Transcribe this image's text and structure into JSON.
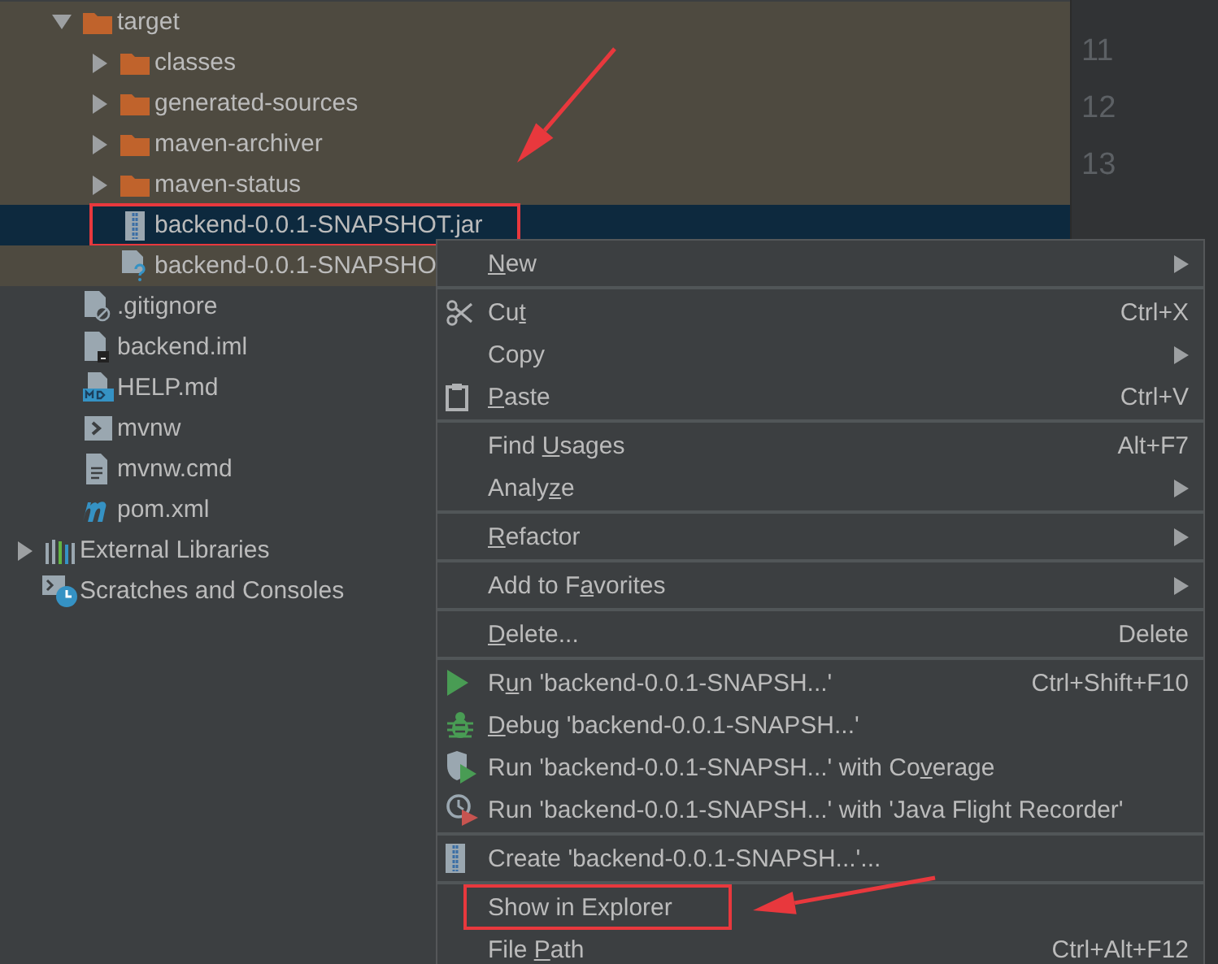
{
  "tree": [
    {
      "kind": "group",
      "children": [
        {
          "kind": "folder",
          "label": "target",
          "expanded": true,
          "selected": false,
          "excluded": true,
          "framed": false,
          "children": [
            {
              "kind": "folder",
              "label": "classes",
              "expanded": false,
              "selected": false,
              "framed": false
            },
            {
              "kind": "folder",
              "label": "generated-sources",
              "expanded": false,
              "selected": false,
              "framed": false
            },
            {
              "kind": "folder",
              "label": "maven-archiver",
              "expanded": false,
              "selected": false,
              "framed": false
            },
            {
              "kind": "folder",
              "label": "maven-status",
              "expanded": false,
              "selected": false,
              "framed": false
            },
            {
              "kind": "jar",
              "label": "backend-0.0.1-SNAPSHOT.jar",
              "selected": true,
              "framed": true
            },
            {
              "kind": "unknown",
              "label": "backend-0.0.1-SNAPSHO",
              "selected": false,
              "framed": false
            }
          ]
        },
        {
          "kind": "gitignore",
          "label": ".gitignore",
          "selected": false,
          "excluded": false,
          "framed": false
        },
        {
          "kind": "iml",
          "label": "backend.iml",
          "selected": false,
          "excluded": false,
          "framed": false
        },
        {
          "kind": "markdown",
          "label": "HELP.md",
          "selected": false,
          "excluded": false,
          "framed": false
        },
        {
          "kind": "shell",
          "label": "mvnw",
          "selected": false,
          "excluded": false,
          "framed": false
        },
        {
          "kind": "text",
          "label": "mvnw.cmd",
          "selected": false,
          "excluded": false,
          "framed": false
        },
        {
          "kind": "maven",
          "label": "pom.xml",
          "selected": false,
          "excluded": false,
          "framed": false
        }
      ]
    },
    {
      "kind": "libraries",
      "label": "External Libraries",
      "expanded": false,
      "selected": false,
      "framed": false
    },
    {
      "kind": "scratches",
      "label": "Scratches and Consoles",
      "selected": false,
      "framed": false
    }
  ],
  "gutter": {
    "line_numbers": [
      "11",
      "12",
      "13"
    ]
  },
  "context_menu": {
    "groups": [
      [
        {
          "kind": "plain",
          "label": [
            {
              "text": "N",
              "underlined": true
            },
            {
              "text": "ew",
              "underlined": false
            }
          ],
          "submenu": true
        }
      ],
      [
        {
          "kind": "cut",
          "label": [
            {
              "text": "Cu",
              "underlined": false
            },
            {
              "text": "t",
              "underlined": true
            }
          ],
          "shortcut": "Ctrl+X"
        },
        {
          "kind": "plain",
          "label": [
            {
              "text": "Copy",
              "underlined": false
            }
          ],
          "submenu": true
        },
        {
          "kind": "paste",
          "label": [
            {
              "text": "P",
              "underlined": true
            },
            {
              "text": "aste",
              "underlined": false
            }
          ],
          "shortcut": "Ctrl+V"
        }
      ],
      [
        {
          "kind": "plain",
          "label": [
            {
              "text": "Find ",
              "underlined": false
            },
            {
              "text": "U",
              "underlined": true
            },
            {
              "text": "sages",
              "underlined": false
            }
          ],
          "shortcut": "Alt+F7"
        },
        {
          "kind": "plain",
          "label": [
            {
              "text": "Analy",
              "underlined": false
            },
            {
              "text": "z",
              "underlined": true
            },
            {
              "text": "e",
              "underlined": false
            }
          ],
          "submenu": true
        }
      ],
      [
        {
          "kind": "plain",
          "label": [
            {
              "text": "R",
              "underlined": true
            },
            {
              "text": "efactor",
              "underlined": false
            }
          ],
          "submenu": true
        }
      ],
      [
        {
          "kind": "plain",
          "label": [
            {
              "text": "Add to F",
              "underlined": false
            },
            {
              "text": "a",
              "underlined": true
            },
            {
              "text": "vorites",
              "underlined": false
            }
          ],
          "submenu": true
        }
      ],
      [
        {
          "kind": "plain",
          "label": [
            {
              "text": "D",
              "underlined": true
            },
            {
              "text": "elete...",
              "underlined": false
            }
          ],
          "shortcut": "Delete"
        }
      ],
      [
        {
          "kind": "run",
          "label": [
            {
              "text": "R",
              "underlined": false
            },
            {
              "text": "u",
              "underlined": true
            },
            {
              "text": "n 'backend-0.0.1-SNAPSH...'",
              "underlined": false
            }
          ],
          "shortcut": "Ctrl+Shift+F10"
        },
        {
          "kind": "debug",
          "label": [
            {
              "text": "D",
              "underlined": true
            },
            {
              "text": "ebug 'backend-0.0.1-SNAPSH...'",
              "underlined": false
            }
          ]
        },
        {
          "kind": "coverage",
          "label": [
            {
              "text": "Run 'backend-0.0.1-SNAPSH...' with Co",
              "underlined": false
            },
            {
              "text": "v",
              "underlined": true
            },
            {
              "text": "erage",
              "underlined": false
            }
          ]
        },
        {
          "kind": "profiler",
          "label": [
            {
              "text": "Run 'backend-0.0.1-SNAPSH...' with 'Java Flight Recorder'",
              "underlined": false
            }
          ]
        }
      ],
      [
        {
          "kind": "archive",
          "label": [
            {
              "text": "Create 'backend-0.0.1-SNAPSH...'...",
              "underlined": false
            }
          ]
        }
      ],
      [
        {
          "kind": "plain",
          "label": [
            {
              "text": "Show in Explorer",
              "underlined": false
            }
          ],
          "framed": true
        },
        {
          "kind": "plain",
          "label": [
            {
              "text": "File ",
              "underlined": false
            },
            {
              "text": "P",
              "underlined": true
            },
            {
              "text": "ath",
              "underlined": false
            }
          ],
          "shortcut": "Ctrl+Alt+F12"
        }
      ]
    ]
  },
  "annotations": [
    {
      "kind": "arrow"
    },
    {
      "kind": "arrow"
    }
  ]
}
